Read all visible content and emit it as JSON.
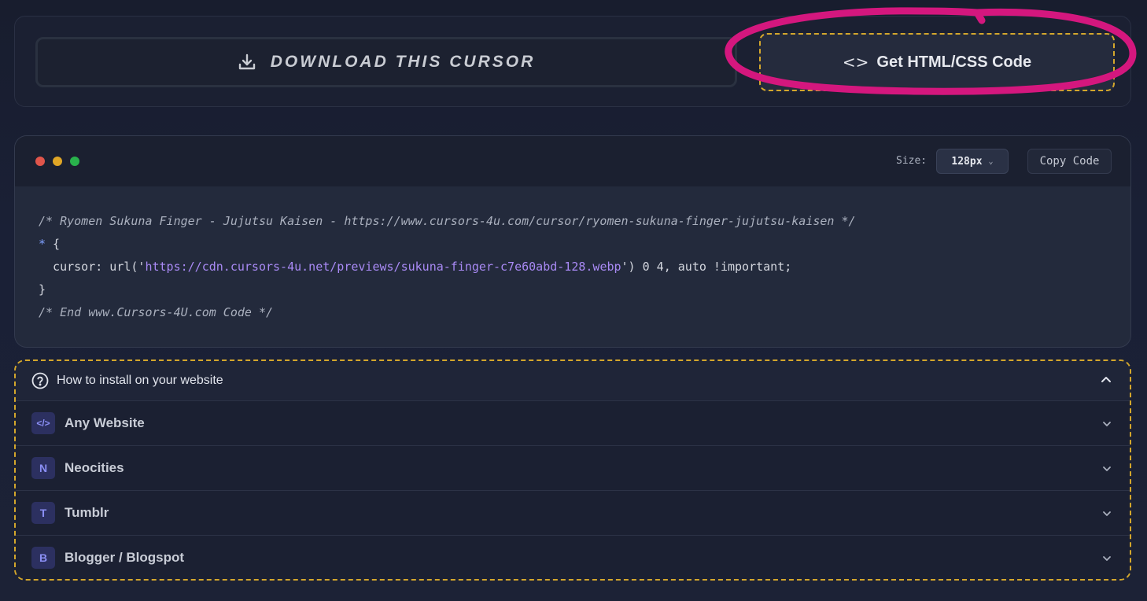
{
  "actions": {
    "download_label": "DOWNLOAD THIS CURSOR",
    "code_label": "Get HTML/CSS Code",
    "code_icon": "<>"
  },
  "code_window": {
    "size_label": "Size:",
    "size_value": "128px",
    "copy_label": "Copy Code",
    "lines": {
      "comment_open": "/* Ryomen Sukuna Finger - Jujutsu Kaisen - https://www.cursors-4u.com/cursor/ryomen-sukuna-finger-jujutsu-kaisen */",
      "selector": "*",
      "brace_open": " {",
      "prop": "  cursor: url('",
      "url": "https://cdn.cursors-4u.net/previews/sukuna-finger-c7e60abd-128.webp",
      "prop_end": "') 0 4, auto !important;",
      "brace_close": "}",
      "comment_close": "/* End www.Cursors-4U.com Code */"
    }
  },
  "install": {
    "title": "How to install on your website",
    "items": [
      {
        "badge": "</>",
        "label": "Any Website"
      },
      {
        "badge": "N",
        "label": "Neocities"
      },
      {
        "badge": "T",
        "label": "Tumblr"
      },
      {
        "badge": "B",
        "label": "Blogger / Blogspot"
      }
    ]
  },
  "colors": {
    "accent_dashed": "#d4a72c",
    "annotation": "#d4177e",
    "badge_text": "#8b8ff5"
  }
}
